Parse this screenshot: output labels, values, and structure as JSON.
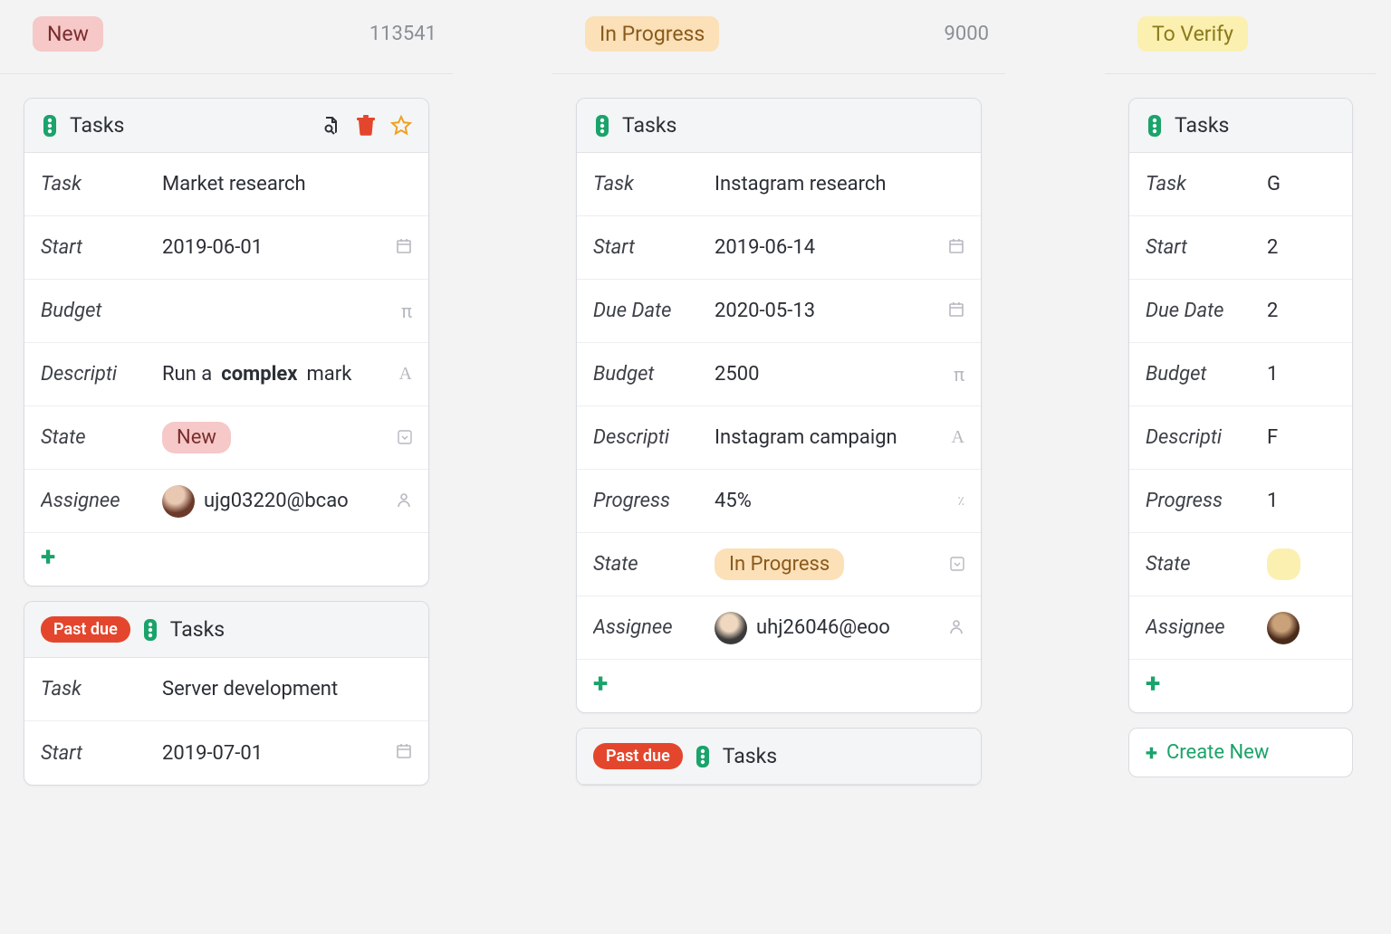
{
  "labels": {
    "task": "Task",
    "start": "Start",
    "due": "Due Date",
    "budget": "Budget",
    "description": "Descripti",
    "progress": "Progress",
    "state": "State",
    "assignee": "Assignee",
    "tasks_title": "Tasks",
    "past_due": "Past due",
    "create_new": "Create New"
  },
  "columns": [
    {
      "key": "new",
      "label": "New",
      "badge_class": "badge-new",
      "count": "113541",
      "cards": [
        {
          "show_toolbar": true,
          "rows": {
            "task": "Market research",
            "start": "2019-06-01",
            "budget": "",
            "description_prefix": "Run a ",
            "description_bold": "complex",
            "description_suffix": " mark",
            "state": "New",
            "state_pill": "pill-new",
            "assignee": "ujg03220@bcao",
            "avatar_class": "a1"
          }
        },
        {
          "past_due": true,
          "rows": {
            "task": "Server development",
            "start": "2019-07-01"
          }
        }
      ]
    },
    {
      "key": "inprogress",
      "label": "In Progress",
      "badge_class": "badge-inprogress",
      "count": "9000",
      "cards": [
        {
          "rows": {
            "task": "Instagram research",
            "start": "2019-06-14",
            "due": "2020-05-13",
            "budget": "2500",
            "description": "Instagram campaign",
            "progress": "45%",
            "state": "In Progress",
            "state_pill": "pill-inprogress",
            "assignee": "uhj26046@eoo",
            "avatar_class": "a2"
          }
        },
        {
          "past_due": true,
          "header_only": true
        }
      ]
    },
    {
      "key": "toverify",
      "label": "To Verify",
      "badge_class": "badge-toverify",
      "count": "",
      "cards": [
        {
          "rows": {
            "task": "G",
            "start": "2",
            "due": "2",
            "budget": "1",
            "description": "F",
            "progress": "1",
            "state": "",
            "state_pill": "pill-toverify",
            "assignee": "",
            "avatar_class": "a3"
          }
        }
      ],
      "create_new": true
    }
  ]
}
